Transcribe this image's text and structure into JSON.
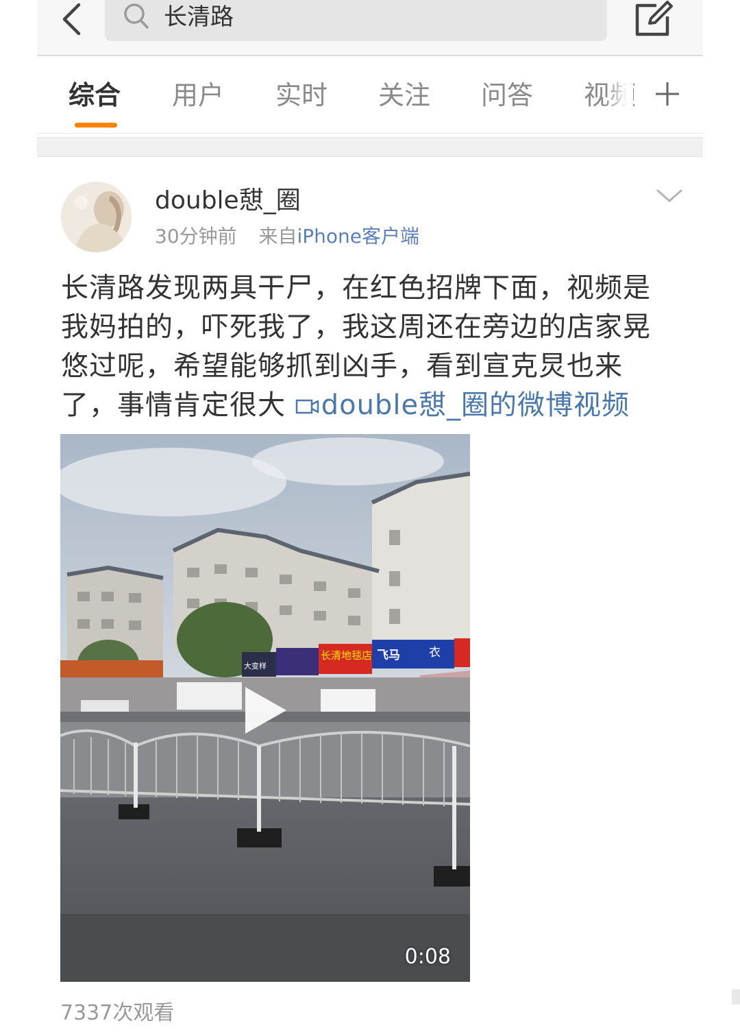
{
  "search": {
    "query": "长清路"
  },
  "tabs": [
    {
      "label": "综合",
      "active": true
    },
    {
      "label": "用户"
    },
    {
      "label": "实时"
    },
    {
      "label": "关注"
    },
    {
      "label": "问答"
    },
    {
      "label": "视频"
    }
  ],
  "post": {
    "username": "double憇_圈",
    "time": "30分钟前",
    "source_prefix": "来自",
    "source_client": "iPhone客户端",
    "text": "长清路发现两具干尸，在红色招牌下面，视频是我妈拍的，吓死我了，我这周还在旁边的店家晃悠过呢，希望能够抓到凶手，看到宣克炅也来了，事情肯定很大 ",
    "video_link": "double憇_圈的微博视频",
    "video": {
      "duration": "0:08",
      "signs": [
        "长清地毯店",
        "飞马",
        "衣",
        "大变样"
      ]
    },
    "view_count": "7337次观看"
  },
  "icons": {
    "back": "chevron-left-icon",
    "search": "search-icon",
    "compose": "compose-icon",
    "more_tabs": "plus-icon",
    "post_menu": "chevron-down-icon",
    "video_link": "video-icon",
    "play": "play-icon"
  },
  "colors": {
    "accent": "#ff8200",
    "link": "#4a78ad",
    "text": "#333333",
    "muted": "#999999"
  }
}
